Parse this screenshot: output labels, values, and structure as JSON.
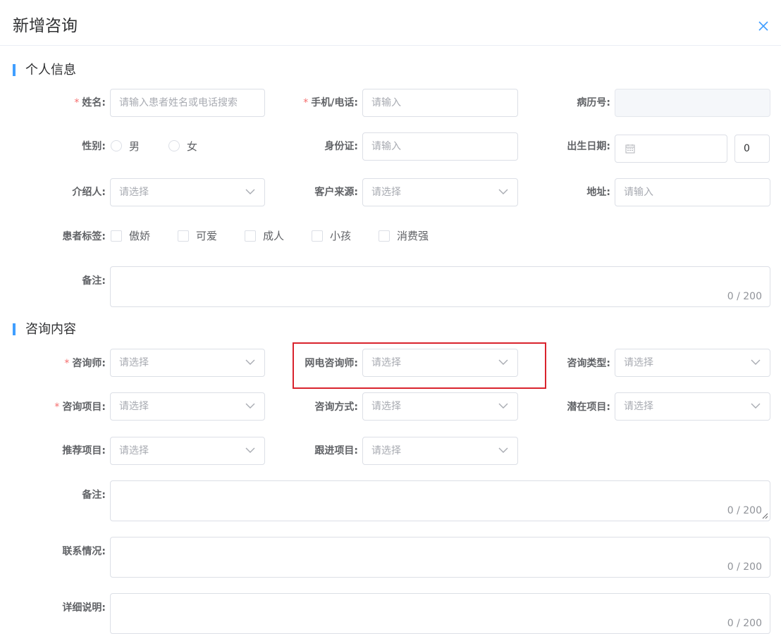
{
  "dialog": {
    "title": "新增咨询"
  },
  "sections": {
    "personal": "个人信息",
    "consult": "咨询内容"
  },
  "personal": {
    "name": {
      "label": "姓名:",
      "placeholder": "请输入患者姓名或电话搜索"
    },
    "phone": {
      "label": "手机/电话:",
      "placeholder": "请输入"
    },
    "record_no": {
      "label": "病历号:"
    },
    "gender": {
      "label": "性别:",
      "options": [
        "男",
        "女"
      ]
    },
    "id_card": {
      "label": "身份证:",
      "placeholder": "请输入"
    },
    "birth": {
      "label": "出生日期:",
      "age_value": "0"
    },
    "referrer": {
      "label": "介绍人:",
      "placeholder": "请选择"
    },
    "source": {
      "label": "客户来源:",
      "placeholder": "请选择"
    },
    "address": {
      "label": "地址:",
      "placeholder": "请输入"
    },
    "tags": {
      "label": "患者标签:",
      "options": [
        "傲娇",
        "可爱",
        "成人",
        "小孩",
        "消费强"
      ]
    },
    "remark": {
      "label": "备注:",
      "count": "0 / 200"
    }
  },
  "consult": {
    "consultant": {
      "label": "咨询师:",
      "placeholder": "请选择"
    },
    "online_consultant": {
      "label": "网电咨询师:",
      "placeholder": "请选择"
    },
    "type": {
      "label": "咨询类型:",
      "placeholder": "请选择"
    },
    "project": {
      "label": "咨询项目:",
      "placeholder": "请选择"
    },
    "method": {
      "label": "咨询方式:",
      "placeholder": "请选择"
    },
    "potential": {
      "label": "潜在项目:",
      "placeholder": "请选择"
    },
    "recommend": {
      "label": "推荐项目:",
      "placeholder": "请选择"
    },
    "followup": {
      "label": "跟进项目:",
      "placeholder": "请选择"
    },
    "remark": {
      "label": "备注:",
      "count": "0 / 200"
    },
    "contact": {
      "label": "联系情况:",
      "count": "0 / 200"
    },
    "detail": {
      "label": "详细说明:",
      "count": "0 / 200"
    }
  },
  "colors": {
    "accent": "#409eff",
    "required": "#f56c6c",
    "highlight": "#d9232d"
  }
}
